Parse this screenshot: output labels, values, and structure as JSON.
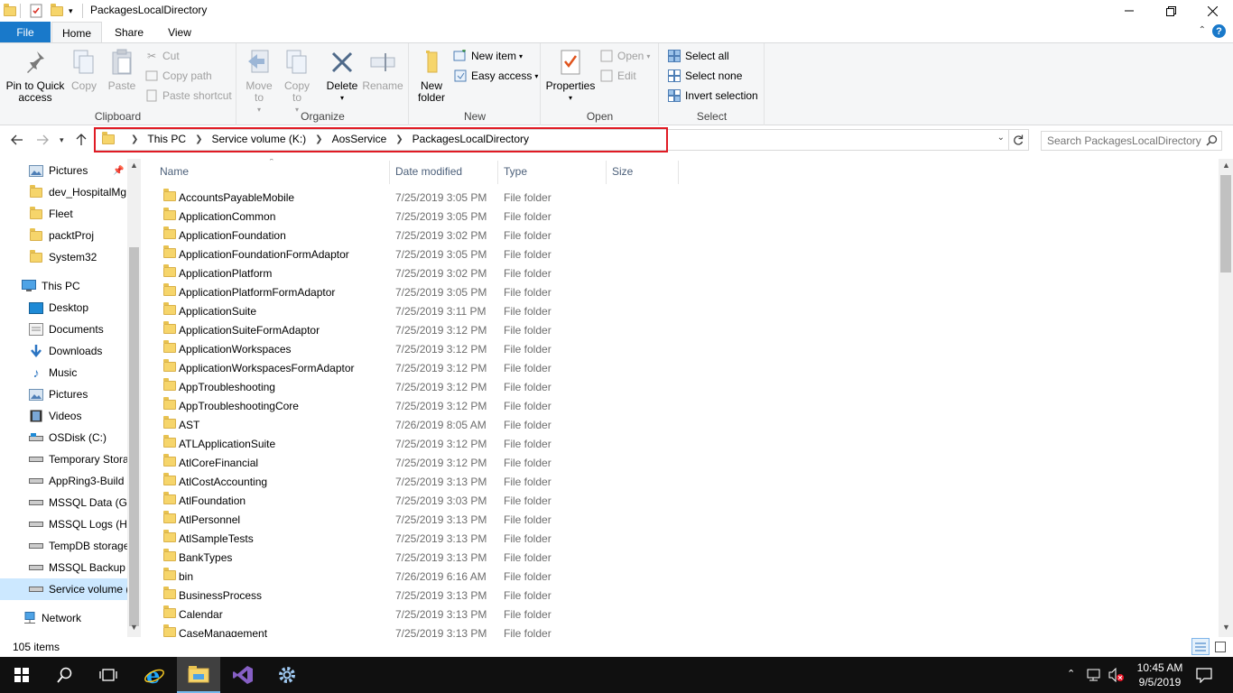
{
  "window": {
    "title": "PackagesLocalDirectory"
  },
  "tabs": [
    "File",
    "Home",
    "Share",
    "View"
  ],
  "ribbon": {
    "clipboard": {
      "label": "Clipboard",
      "pin_to_quick_access": "Pin to Quick access",
      "copy": "Copy",
      "paste": "Paste",
      "cut": "Cut",
      "copy_path": "Copy path",
      "paste_shortcut": "Paste shortcut"
    },
    "organize": {
      "label": "Organize",
      "move_to": "Move to",
      "copy_to": "Copy to",
      "delete": "Delete",
      "rename": "Rename"
    },
    "new": {
      "label": "New",
      "new_folder": "New folder",
      "new_item": "New item",
      "easy_access": "Easy access"
    },
    "open": {
      "label": "Open",
      "properties": "Properties",
      "open": "Open",
      "edit": "Edit"
    },
    "select": {
      "label": "Select",
      "select_all": "Select all",
      "select_none": "Select none",
      "invert_selection": "Invert selection"
    }
  },
  "address": {
    "crumbs": [
      "This PC",
      "Service volume (K:)",
      "AosService",
      "PackagesLocalDirectory"
    ],
    "search_placeholder": "Search PackagesLocalDirectory"
  },
  "nav_pane": {
    "items": [
      {
        "label": "Pictures",
        "icon": "pictures-icon",
        "level": 1
      },
      {
        "label": "dev_HospitalMg",
        "icon": "folder-icon",
        "level": 1
      },
      {
        "label": "Fleet",
        "icon": "folder-icon",
        "level": 1
      },
      {
        "label": "packtProj",
        "icon": "folder-icon",
        "level": 1
      },
      {
        "label": "System32",
        "icon": "folder-icon",
        "level": 1
      },
      {
        "label": "This PC",
        "icon": "computer-icon",
        "level": 0
      },
      {
        "label": "Desktop",
        "icon": "desktop-icon",
        "level": 1
      },
      {
        "label": "Documents",
        "icon": "documents-icon",
        "level": 1
      },
      {
        "label": "Downloads",
        "icon": "downloads-icon",
        "level": 1
      },
      {
        "label": "Music",
        "icon": "music-icon",
        "level": 1
      },
      {
        "label": "Pictures",
        "icon": "pictures-icon",
        "level": 1
      },
      {
        "label": "Videos",
        "icon": "videos-icon",
        "level": 1
      },
      {
        "label": "OSDisk (C:)",
        "icon": "drive-icon",
        "level": 1
      },
      {
        "label": "Temporary Stora",
        "icon": "drive-icon",
        "level": 1
      },
      {
        "label": "AppRing3-Build",
        "icon": "drive-icon",
        "level": 1
      },
      {
        "label": "MSSQL Data (G:)",
        "icon": "drive-icon",
        "level": 1
      },
      {
        "label": "MSSQL Logs (H:",
        "icon": "drive-icon",
        "level": 1
      },
      {
        "label": "TempDB storage",
        "icon": "drive-icon",
        "level": 1
      },
      {
        "label": "MSSQL Backup (",
        "icon": "drive-icon",
        "level": 1
      },
      {
        "label": "Service volume (",
        "icon": "drive-icon",
        "level": 1,
        "selected": true
      },
      {
        "label": "Network",
        "icon": "network-icon",
        "level": 0
      }
    ]
  },
  "columns": {
    "name": "Name",
    "date_modified": "Date modified",
    "type": "Type",
    "size": "Size"
  },
  "files": [
    {
      "name": "AccountsPayableMobile",
      "date": "7/25/2019 3:05 PM",
      "type": "File folder"
    },
    {
      "name": "ApplicationCommon",
      "date": "7/25/2019 3:05 PM",
      "type": "File folder"
    },
    {
      "name": "ApplicationFoundation",
      "date": "7/25/2019 3:02 PM",
      "type": "File folder"
    },
    {
      "name": "ApplicationFoundationFormAdaptor",
      "date": "7/25/2019 3:05 PM",
      "type": "File folder"
    },
    {
      "name": "ApplicationPlatform",
      "date": "7/25/2019 3:02 PM",
      "type": "File folder"
    },
    {
      "name": "ApplicationPlatformFormAdaptor",
      "date": "7/25/2019 3:05 PM",
      "type": "File folder"
    },
    {
      "name": "ApplicationSuite",
      "date": "7/25/2019 3:11 PM",
      "type": "File folder"
    },
    {
      "name": "ApplicationSuiteFormAdaptor",
      "date": "7/25/2019 3:12 PM",
      "type": "File folder"
    },
    {
      "name": "ApplicationWorkspaces",
      "date": "7/25/2019 3:12 PM",
      "type": "File folder"
    },
    {
      "name": "ApplicationWorkspacesFormAdaptor",
      "date": "7/25/2019 3:12 PM",
      "type": "File folder"
    },
    {
      "name": "AppTroubleshooting",
      "date": "7/25/2019 3:12 PM",
      "type": "File folder"
    },
    {
      "name": "AppTroubleshootingCore",
      "date": "7/25/2019 3:12 PM",
      "type": "File folder"
    },
    {
      "name": "AST",
      "date": "7/26/2019 8:05 AM",
      "type": "File folder"
    },
    {
      "name": "ATLApplicationSuite",
      "date": "7/25/2019 3:12 PM",
      "type": "File folder"
    },
    {
      "name": "AtlCoreFinancial",
      "date": "7/25/2019 3:12 PM",
      "type": "File folder"
    },
    {
      "name": "AtlCostAccounting",
      "date": "7/25/2019 3:13 PM",
      "type": "File folder"
    },
    {
      "name": "AtlFoundation",
      "date": "7/25/2019 3:03 PM",
      "type": "File folder"
    },
    {
      "name": "AtlPersonnel",
      "date": "7/25/2019 3:13 PM",
      "type": "File folder"
    },
    {
      "name": "AtlSampleTests",
      "date": "7/25/2019 3:13 PM",
      "type": "File folder"
    },
    {
      "name": "BankTypes",
      "date": "7/25/2019 3:13 PM",
      "type": "File folder"
    },
    {
      "name": "bin",
      "date": "7/26/2019 6:16 AM",
      "type": "File folder"
    },
    {
      "name": "BusinessProcess",
      "date": "7/25/2019 3:13 PM",
      "type": "File folder"
    },
    {
      "name": "Calendar",
      "date": "7/25/2019 3:13 PM",
      "type": "File folder"
    },
    {
      "name": "CaseManagement",
      "date": "7/25/2019 3:13 PM",
      "type": "File folder"
    }
  ],
  "status": {
    "item_count": "105 items"
  },
  "taskbar": {
    "time": "10:45 AM",
    "date": "9/5/2019"
  },
  "colors": {
    "accent": "#1979ca",
    "highlight_border": "#e01b24",
    "folder_yellow": "#f6d56b",
    "selection": "#cce8ff"
  }
}
